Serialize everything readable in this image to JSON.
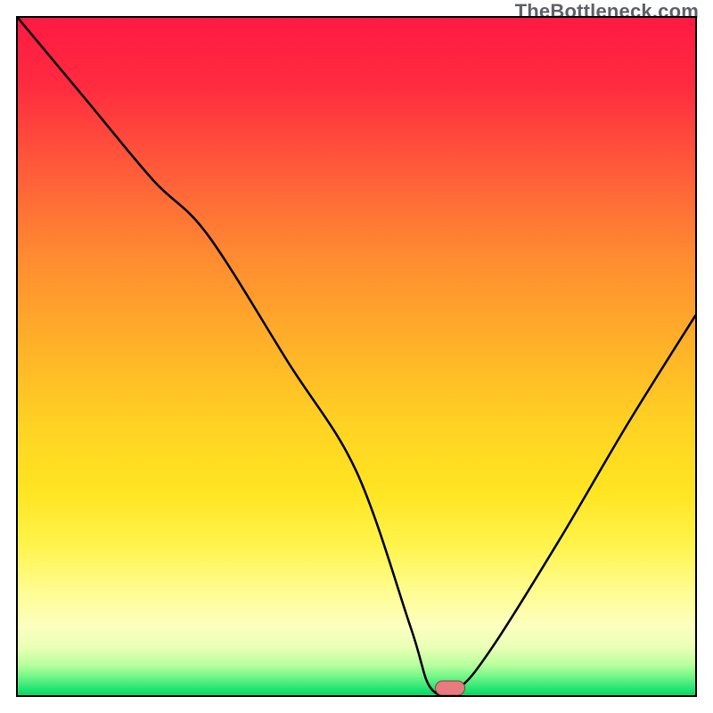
{
  "watermark": "TheBottleneck.com",
  "marker": {
    "x_pct": 63.8,
    "y_pct": 99.0
  },
  "chart_data": {
    "type": "line",
    "title": "",
    "xlabel": "",
    "ylabel": "",
    "xlim": [
      0,
      100
    ],
    "ylim": [
      0,
      100
    ],
    "series": [
      {
        "name": "bottleneck-curve",
        "x": [
          0,
          10,
          20,
          28,
          40,
          50,
          58,
          61,
          65,
          70,
          80,
          90,
          100
        ],
        "y": [
          100,
          88,
          76,
          68,
          49,
          33,
          10,
          1,
          1,
          7,
          23,
          40,
          56
        ]
      }
    ],
    "background_gradient": {
      "orientation": "vertical",
      "stops": [
        {
          "pos": 0.0,
          "color": "#ff1a43"
        },
        {
          "pos": 0.22,
          "color": "#ff5a3a"
        },
        {
          "pos": 0.48,
          "color": "#ffb029"
        },
        {
          "pos": 0.7,
          "color": "#ffe522"
        },
        {
          "pos": 0.9,
          "color": "#fcffc0"
        },
        {
          "pos": 1.0,
          "color": "#0fd466"
        }
      ]
    },
    "marker": {
      "x": 63.8,
      "y": 1.0,
      "color": "#e97a7f"
    }
  }
}
